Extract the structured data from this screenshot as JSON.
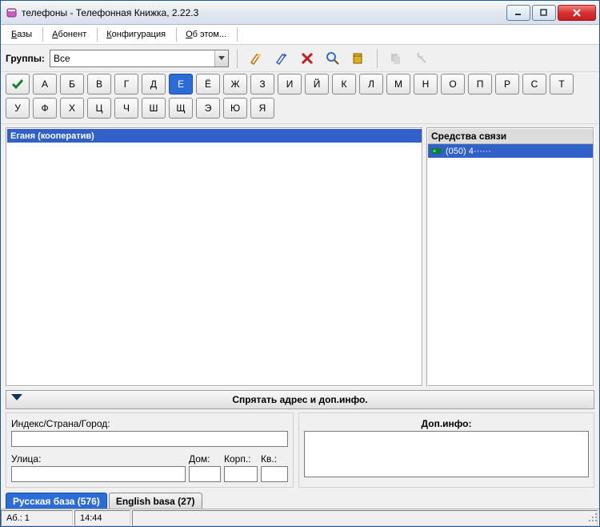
{
  "window": {
    "title": "телефоны - Телефонная Книжка, 2.22.3"
  },
  "menu": {
    "db": "Базы",
    "sub": "Абонент",
    "conf": "Конфигурация",
    "about": "Об этом..."
  },
  "toolbar": {
    "groups_label": "Группы:",
    "group_value": "Все"
  },
  "alpha": {
    "row": [
      "А",
      "Б",
      "В",
      "Г",
      "Д",
      "Е",
      "Ё",
      "Ж",
      "З",
      "И",
      "Й",
      "К",
      "Л",
      "М",
      "Н",
      "О",
      "П",
      "Р",
      "С",
      "Т",
      "У",
      "Ф",
      "Х",
      "Ц",
      "Ч",
      "Ш",
      "Щ",
      "Э",
      "Ю",
      "Я"
    ],
    "active": "Е"
  },
  "list": {
    "selected": "Еганя (кооператив)"
  },
  "contacts": {
    "header": "Средства связи",
    "items": [
      {
        "text": "(050) 4······"
      }
    ]
  },
  "hidebar": {
    "label": "Спрятать адрес и доп.инфо."
  },
  "address": {
    "idx_label": "Индекс/Страна/Город:",
    "street_label": "Улица:",
    "house_label": "Дом:",
    "korp_label": "Корп.:",
    "apt_label": "Кв.:",
    "extra_label": "Доп.инфо:"
  },
  "tabs": {
    "ru": "Русская база (576)",
    "en": "English basa (27)"
  },
  "status": {
    "count": "Аб.: 1",
    "time": "14:44"
  }
}
